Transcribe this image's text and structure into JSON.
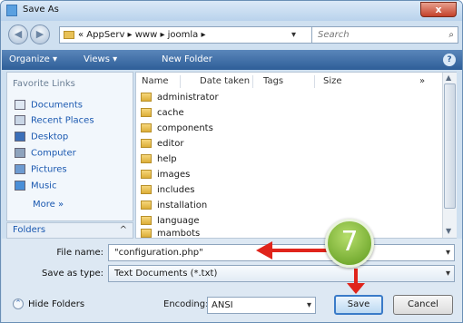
{
  "window": {
    "title": "Save As",
    "close_symbol": "x"
  },
  "address": {
    "segments": "« AppServ ▸ www ▸ joomla ▸",
    "search_placeholder": "Search"
  },
  "toolbar": {
    "organize": "Organize ▾",
    "views": "Views ▾",
    "new_folder": "New Folder",
    "help": "?"
  },
  "nav": {
    "header": "Favorite Links",
    "items": [
      "Documents",
      "Recent Places",
      "Desktop",
      "Computer",
      "Pictures",
      "Music"
    ],
    "more": "More »",
    "folders": "Folders"
  },
  "columns": [
    "Name",
    "Date taken",
    "Tags",
    "Size"
  ],
  "files": [
    "administrator",
    "cache",
    "components",
    "editor",
    "help",
    "images",
    "includes",
    "installation",
    "language",
    "mambots"
  ],
  "form": {
    "file_name_label": "File name:",
    "file_name_value": "\"configuration.php\"",
    "save_type_label": "Save as type:",
    "save_type_value": "Text Documents (*.txt)",
    "hide_folders": "Hide Folders",
    "encoding_label": "Encoding:",
    "encoding_value": "ANSI",
    "save": "Save",
    "cancel": "Cancel"
  },
  "callout": {
    "step": "7"
  },
  "colors": {
    "arrow": "#e0241b",
    "accent": "#2e5e98",
    "callout": "#6ea62a"
  }
}
